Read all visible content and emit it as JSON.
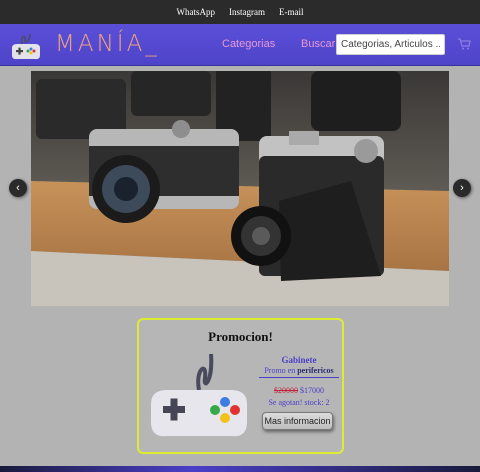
{
  "topbar": {
    "links": [
      "WhatsApp",
      "Instagram",
      "E-mail"
    ]
  },
  "header": {
    "brand": "MANÍA_",
    "nav": {
      "categorias": "Categorias",
      "buscar": "Buscar"
    },
    "search_placeholder": "Categorias, Articulos ...",
    "logo_icon": "gamepad-icon",
    "cart_icon": "cart-icon"
  },
  "carousel": {
    "prev_glyph": "‹",
    "next_glyph": "›",
    "slide_subject": "vintage-cameras-photo"
  },
  "promo": {
    "title": "Promocion!",
    "product_name": "Gabinete",
    "promo_prefix": "Promo en",
    "promo_category": "perifericos",
    "old_price": "$20000",
    "new_price": "$17000",
    "stock_text": "Se agotan! stock: 2",
    "button_label": "Mas informacion",
    "image_icon": "gamepad-icon"
  },
  "colors": {
    "header": "#4e44c9",
    "brand": "#f0a47a",
    "nav": "#e89ad8",
    "promo_border": "#dcec34",
    "accent_text": "#4b3fc7",
    "old_price": "#c0243a"
  }
}
